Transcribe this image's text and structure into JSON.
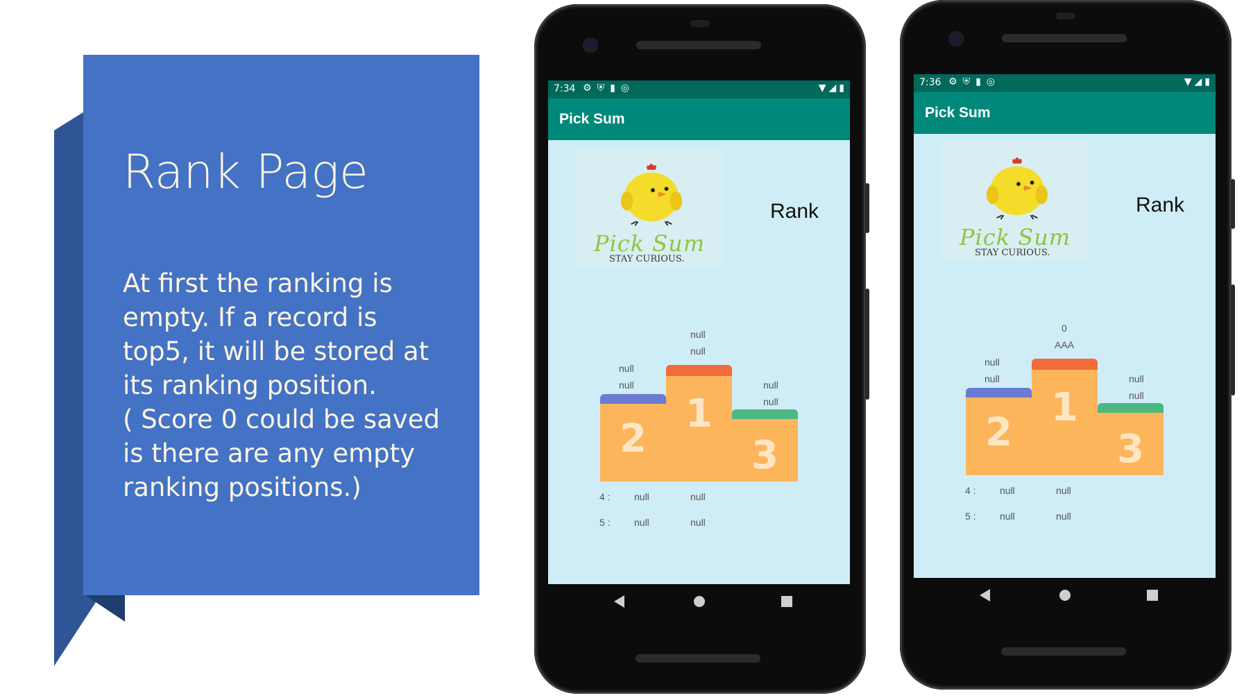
{
  "slide": {
    "title": "Rank Page",
    "body": "At first the ranking is\nempty. If a record is\ntop5, it will be stored at\nits ranking position.\n( Score 0 could be saved\nis there are any empty\nranking positions.)"
  },
  "phone1": {
    "time": "7:34",
    "app_title": "Pick Sum",
    "logo_text": "Pick Sum",
    "logo_tag": "STAY CURIOUS.",
    "rank_heading": "Rank",
    "first": {
      "line1": "null",
      "line2": "null"
    },
    "second": {
      "line1": "null",
      "line2": "null"
    },
    "third": {
      "line1": "null",
      "line2": "null"
    },
    "podium_labels": [
      "1",
      "2",
      "3"
    ],
    "row4": {
      "label": "4 :",
      "score": "null",
      "name": "null"
    },
    "row5": {
      "label": "5 :",
      "score": "null",
      "name": "null"
    }
  },
  "phone2": {
    "time": "7:36",
    "app_title": "Pick Sum",
    "logo_text": "Pick Sum",
    "logo_tag": "STAY CURIOUS.",
    "rank_heading": "Rank",
    "first": {
      "line1": "0",
      "line2": "AAA"
    },
    "second": {
      "line1": "null",
      "line2": "null"
    },
    "third": {
      "line1": "null",
      "line2": "null"
    },
    "podium_labels": [
      "1",
      "2",
      "3"
    ],
    "row4": {
      "label": "4 :",
      "score": "null",
      "name": "null"
    },
    "row5": {
      "label": "5 :",
      "score": "null",
      "name": "null"
    }
  },
  "colors": {
    "banner": "#4472c4",
    "banner_shadow": "#2f5597",
    "appbar": "#00897b",
    "statusbar": "#00695c",
    "screen_bg": "#cfedf6",
    "podium": "#fdb55c",
    "podium_cap_1": "#f26b3a",
    "podium_cap_2": "#6b7bd1",
    "podium_cap_3": "#4cb782"
  },
  "icons": [
    "settings-icon",
    "shield-icon",
    "sd-card-icon",
    "at-icon",
    "wifi-icon",
    "signal-icon",
    "battery-icon",
    "back-icon",
    "home-icon",
    "recents-icon"
  ]
}
